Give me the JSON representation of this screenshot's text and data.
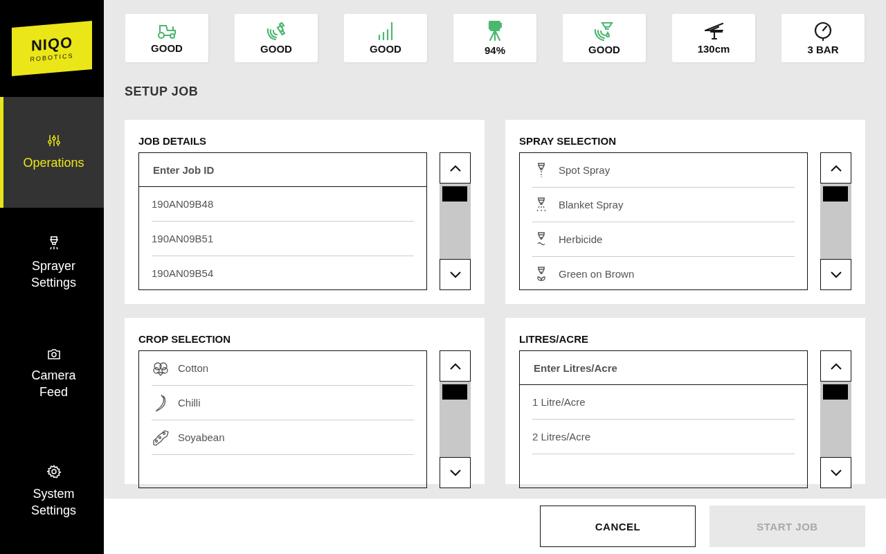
{
  "logo": {
    "name": "NIQO",
    "tagline": "ROBOTICS"
  },
  "nav": [
    {
      "label": "Operations",
      "kind": "sliders",
      "selected": true
    },
    {
      "label": "Sprayer Settings",
      "kind": "nozzle",
      "selected": false
    },
    {
      "label": "Camera Feed",
      "kind": "camera",
      "selected": false
    },
    {
      "label": "System Settings",
      "kind": "gear",
      "selected": false
    }
  ],
  "status_tiles": [
    {
      "kind": "tractor",
      "value": "GOOD",
      "color": "#4cb86f"
    },
    {
      "kind": "satellite",
      "value": "GOOD",
      "color": "#4cb86f"
    },
    {
      "kind": "signal",
      "value": "GOOD",
      "color": "#4cb86f"
    },
    {
      "kind": "battery",
      "value": "94%",
      "color": "#4cb86f"
    },
    {
      "kind": "spray",
      "value": "GOOD",
      "color": "#4cb86f"
    },
    {
      "kind": "boom",
      "value": "130cm",
      "color": "#1a1a1a"
    },
    {
      "kind": "gauge",
      "value": "3 BAR",
      "color": "#1a1a1a"
    }
  ],
  "page_title": "SETUP JOB",
  "panels": [
    {
      "title": "JOB DETAILS",
      "placeholder": "Enter Job ID",
      "items": [
        {
          "label": "190AN09B48"
        },
        {
          "label": "190AN09B51"
        },
        {
          "label": "190AN09B54"
        }
      ]
    },
    {
      "title": "SPRAY SELECTION",
      "items": [
        {
          "label": "Spot Spray",
          "kind": "spot"
        },
        {
          "label": "Blanket Spray",
          "kind": "blanket"
        },
        {
          "label": "Herbicide",
          "kind": "herbicide"
        },
        {
          "label": "Green on Brown",
          "kind": "gob"
        }
      ]
    },
    {
      "title": "CROP SELECTION",
      "items": [
        {
          "label": "Cotton",
          "kind": "cotton"
        },
        {
          "label": "Chilli",
          "kind": "chilli"
        },
        {
          "label": "Soyabean",
          "kind": "soyabean"
        }
      ]
    },
    {
      "title": "LITRES/ACRE",
      "placeholder": "Enter Litres/Acre",
      "items": [
        {
          "label": "1 Litre/Acre"
        },
        {
          "label": "2 Litres/Acre"
        }
      ]
    }
  ],
  "buttons": [
    {
      "label": "CANCEL",
      "disabled": false
    },
    {
      "label": "START JOB",
      "disabled": true
    }
  ]
}
